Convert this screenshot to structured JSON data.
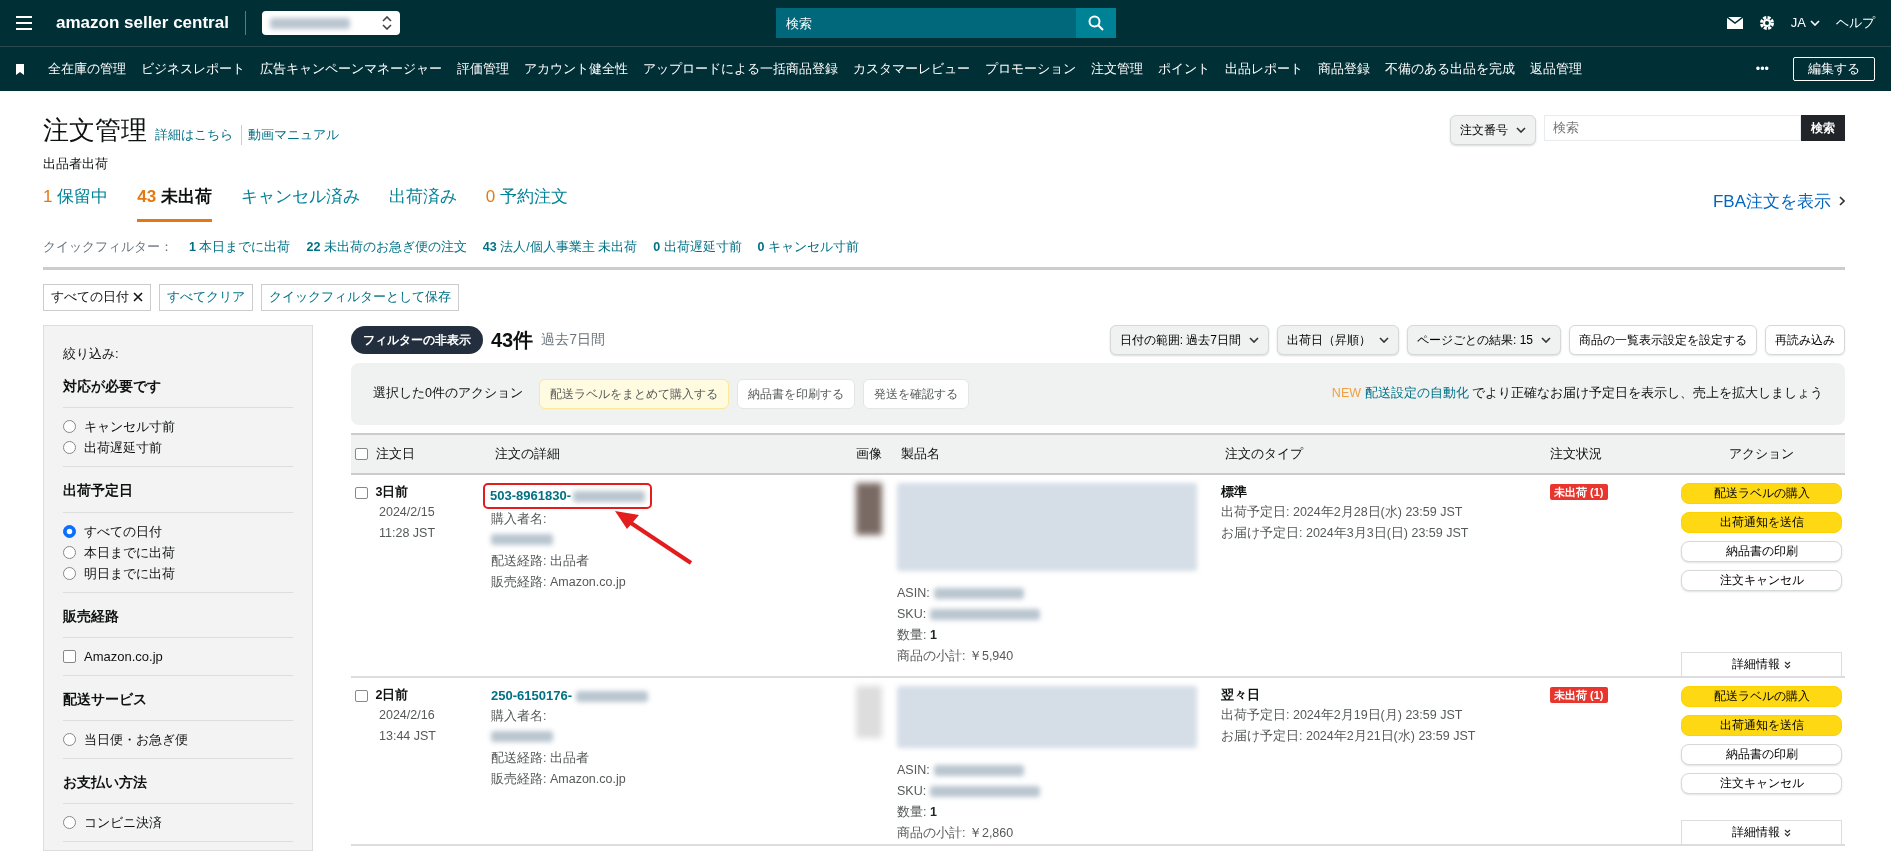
{
  "topbar": {
    "logo": "amazon seller central",
    "search": {
      "placeholder": "検索"
    },
    "language": "JA",
    "help": "ヘルプ"
  },
  "nav": {
    "items": [
      "全在庫の管理",
      "ビジネスレポート",
      "広告キャンペーンマネージャー",
      "評価管理",
      "アカウント健全性",
      "アップロードによる一括商品登録",
      "カスタマーレビュー",
      "プロモーション",
      "注文管理",
      "ポイント",
      "出品レポート",
      "商品登録",
      "不備のある出品を完成",
      "返品管理"
    ],
    "more": "•••",
    "edit": "編集する"
  },
  "header": {
    "title": "注文管理",
    "links": [
      "詳細はこちら",
      "動画マニュアル"
    ],
    "subtitle": "出品者出荷",
    "search": {
      "scope": "注文番号",
      "placeholder": "検索",
      "button": "検索"
    }
  },
  "tabs": [
    {
      "count": "1",
      "label": "保留中",
      "selected": false
    },
    {
      "count": "43",
      "label": "未出荷",
      "selected": true
    },
    {
      "label": "キャンセル済み",
      "selected": false
    },
    {
      "label": "出荷済み",
      "selected": false
    },
    {
      "count": "0",
      "label": "予約注文",
      "selected": false
    }
  ],
  "fba_link": "FBA注文を表示",
  "quick_filters": {
    "label": "クイックフィルター：",
    "items": [
      {
        "count": "1",
        "label": "本日までに出荷"
      },
      {
        "count": "22",
        "label": "未出荷のお急ぎ便の注文"
      },
      {
        "count": "43",
        "label": "法人/個人事業主 未出荷"
      },
      {
        "count": "0",
        "label": "出荷遅延寸前"
      },
      {
        "count": "0",
        "label": "キャンセル寸前"
      }
    ]
  },
  "chips": [
    {
      "label": "すべての日付",
      "removable": true
    },
    {
      "label": "すべてクリア",
      "removable": false
    },
    {
      "label": "クイックフィルターとして保存",
      "removable": false
    }
  ],
  "sidebar": {
    "title": "絞り込み:",
    "sections": [
      {
        "title": "対応が必要です",
        "options": [
          {
            "kind": "radio",
            "label": "キャンセル寸前",
            "selected": false
          },
          {
            "kind": "radio",
            "label": "出荷遅延寸前",
            "selected": false
          }
        ]
      },
      {
        "title": "出荷予定日",
        "options": [
          {
            "kind": "radio",
            "label": "すべての日付",
            "selected": true
          },
          {
            "kind": "radio",
            "label": "本日までに出荷",
            "selected": false
          },
          {
            "kind": "radio",
            "label": "明日までに出荷",
            "selected": false
          }
        ]
      },
      {
        "title": "販売経路",
        "options": [
          {
            "kind": "checkbox",
            "label": "Amazon.co.jp",
            "checked": false
          }
        ]
      },
      {
        "title": "配送サービス",
        "options": [
          {
            "kind": "radio",
            "label": "当日便・お急ぎ便",
            "selected": false
          }
        ]
      },
      {
        "title": "お支払い方法",
        "options": [
          {
            "kind": "radio",
            "label": "コンビニ決済",
            "selected": false
          }
        ]
      }
    ]
  },
  "toolbar": {
    "toggle": "フィルターの非表示",
    "total": "43件",
    "period": "過去7日間",
    "dropdowns": [
      "日付の範囲: 過去7日間",
      "出荷日（昇順）",
      "ページごとの結果: 15"
    ],
    "buttons": [
      "商品の一覧表示設定を設定する",
      "再読み込み"
    ]
  },
  "action_bar": {
    "label": "選択した0件のアクション",
    "buttons": [
      {
        "label": "配送ラベルをまとめて購入する",
        "kind": "primary"
      },
      {
        "label": "納品書を印刷する",
        "kind": "secondary"
      },
      {
        "label": "発送を確認する",
        "kind": "secondary"
      }
    ],
    "promo": {
      "badge": "NEW",
      "link": "配送設定の自動化",
      "text": " でより正確なお届け予定日を表示し、売上を拡大しましょう"
    }
  },
  "table": {
    "select_all_checked": false,
    "columns": [
      "注文日",
      "注文の詳細",
      "画像",
      "製品名",
      "注文のタイプ",
      "注文状況",
      "アクション"
    ],
    "rows": [
      {
        "checked": false,
        "age": "3日前",
        "date": "2024/2/15",
        "time": "11:28 JST",
        "order_id": "503-8961830-",
        "highlighted": true,
        "buyer_label": "購入者名:",
        "fulfillment": "配送経路: 出品者",
        "channel": "販売経路: Amazon.co.jp",
        "asin_label": "ASIN:",
        "sku_label": "SKU:",
        "quantity_label": "数量:",
        "quantity": "1",
        "subtotal": "商品の小計: ￥5,940",
        "order_type": "標準",
        "ship_by": "出荷予定日: 2024年2月28日(水) 23:59 JST",
        "deliver_by": "お届け予定日: 2024年3月3日(日) 23:59 JST",
        "status": "未出荷 (1)",
        "actions": [
          {
            "label": "配送ラベルの購入",
            "kind": "primary"
          },
          {
            "label": "出荷通知を送信",
            "kind": "primary"
          },
          {
            "label": "納品書の印刷",
            "kind": "secondary"
          },
          {
            "label": "注文キャンセル",
            "kind": "secondary"
          }
        ],
        "details": "詳細情報"
      },
      {
        "checked": false,
        "age": "2日前",
        "date": "2024/2/16",
        "time": "13:44 JST",
        "order_id": "250-6150176-",
        "highlighted": false,
        "buyer_label": "購入者名:",
        "fulfillment": "配送経路: 出品者",
        "channel": "販売経路: Amazon.co.jp",
        "asin_label": "ASIN:",
        "sku_label": "SKU:",
        "quantity_label": "数量:",
        "quantity": "1",
        "subtotal": "商品の小計: ￥2,860",
        "order_type": "翌々日",
        "ship_by": "出荷予定日: 2024年2月19日(月) 23:59 JST",
        "deliver_by": "お届け予定日: 2024年2月21日(水) 23:59 JST",
        "status": "未出荷 (1)",
        "actions": [
          {
            "label": "配送ラベルの購入",
            "kind": "primary"
          },
          {
            "label": "出荷通知を送信",
            "kind": "primary"
          },
          {
            "label": "納品書の印刷",
            "kind": "secondary"
          },
          {
            "label": "注文キャンセル",
            "kind": "secondary"
          }
        ],
        "details": "詳細情報"
      }
    ]
  }
}
